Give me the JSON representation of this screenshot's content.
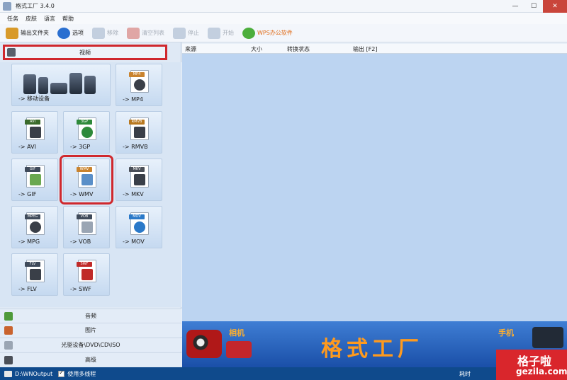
{
  "window": {
    "title": "格式工厂 3.4.0",
    "min": "—",
    "max": "☐",
    "close": "✕"
  },
  "menu": [
    "任务",
    "皮肤",
    "语言",
    "帮助"
  ],
  "toolbar": [
    {
      "label": "输出文件夹",
      "icon": "output-folder-icon",
      "enabled": true,
      "color": "#d89a2a"
    },
    {
      "label": "选项",
      "icon": "options-gear-icon",
      "enabled": true,
      "color": "#2a6fd0"
    },
    {
      "label": "移除",
      "icon": "remove-icon",
      "enabled": false,
      "color": "#8aa0bd"
    },
    {
      "label": "清空列表",
      "icon": "clear-list-icon",
      "enabled": false,
      "color": "#c9453b"
    },
    {
      "label": "停止",
      "icon": "stop-icon",
      "enabled": false,
      "color": "#8aa0bd"
    },
    {
      "label": "开始",
      "icon": "start-icon",
      "enabled": false,
      "color": "#8aa0bd"
    },
    {
      "label": "WPS办公软件",
      "icon": "wps-icon",
      "enabled": true,
      "color": "#4cae3c"
    }
  ],
  "video_category": {
    "label": "视频"
  },
  "tiles": [
    {
      "label": "-> 移动设备",
      "format": "",
      "tag_color": ""
    },
    {
      "label": "-> MP4",
      "format": "MP4",
      "tag_color": "#c9832e"
    },
    {
      "label": "-> AVI",
      "format": "AVI",
      "tag_color": "#3a6a2a"
    },
    {
      "label": "-> 3GP",
      "format": "3GP",
      "tag_color": "#2e8a3a"
    },
    {
      "label": "-> RMVB",
      "format": "RMVB",
      "tag_color": "#b8781f"
    },
    {
      "label": "-> GIF",
      "format": "GIF",
      "tag_color": "#3f4a5a"
    },
    {
      "label": "-> WMV",
      "format": "WMV",
      "tag_color": "#c9832e"
    },
    {
      "label": "-> MKV",
      "format": "MKV",
      "tag_color": "#4a4f58"
    },
    {
      "label": "-> MPG",
      "format": "MPEG",
      "tag_color": "#3f4a5a"
    },
    {
      "label": "-> VOB",
      "format": "VOB",
      "tag_color": "#3f4a5a"
    },
    {
      "label": "-> MOV",
      "format": "MOV",
      "tag_color": "#2a79c9"
    },
    {
      "label": "-> FLV",
      "format": "FLV",
      "tag_color": "#3f4a5a"
    },
    {
      "label": "-> SWF",
      "format": "SWF",
      "tag_color": "#c02a28"
    }
  ],
  "categories": [
    {
      "label": "音频",
      "icon": "audio-note-icon",
      "color": "#4e9a3a"
    },
    {
      "label": "图片",
      "icon": "picture-icon",
      "color": "#c9632e"
    },
    {
      "label": "光驱设备\\DVD\\CD\\ISO",
      "icon": "disc-drive-icon",
      "color": "#9aa5b3"
    },
    {
      "label": "高级",
      "icon": "advanced-icon",
      "color": "#4a4f58"
    }
  ],
  "list_columns": [
    "来源",
    "大小",
    "转换状态",
    "输出 [F2]"
  ],
  "banner": {
    "camera_label": "相机",
    "brand": "格式工厂",
    "phone_label": "手机"
  },
  "status": {
    "output_path": "D:\\WNOutput",
    "multithread_label": "使用多线程",
    "multithread_checked": true,
    "elapsed_label": "耗时"
  },
  "watermark": {
    "cn": "格子啦",
    "en": "gezila.com"
  }
}
